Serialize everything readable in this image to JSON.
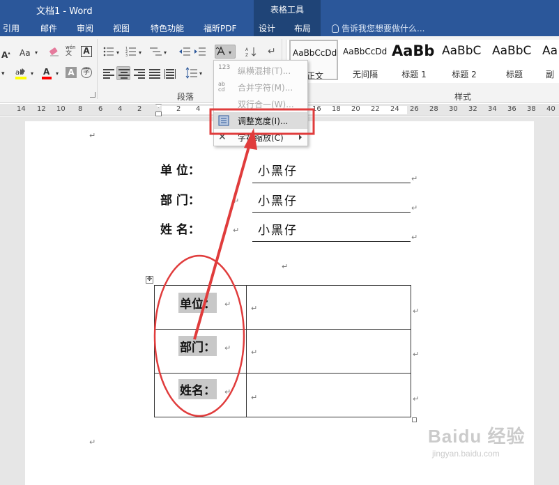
{
  "window": {
    "title": "文档1 - Word",
    "contextual_tab_group": "表格工具"
  },
  "tabs": [
    {
      "label": "引用"
    },
    {
      "label": "邮件"
    },
    {
      "label": "审阅"
    },
    {
      "label": "视图"
    },
    {
      "label": "特色功能"
    },
    {
      "label": "福昕PDF"
    },
    {
      "label": "设计"
    },
    {
      "label": "布局"
    }
  ],
  "tell_me": {
    "placeholder": "告诉我您想要做什么..."
  },
  "ribbon": {
    "font_size_btn": "Aa",
    "phonetic_btn": "wén",
    "char_border_btn": "A",
    "font_color_btn": "A",
    "shading_btn": "A",
    "enclose_btn": "字",
    "groups": {
      "paragraph_label": "段落",
      "styles_label": "样式"
    },
    "styles": [
      {
        "sample": "AaBbCcDd",
        "name": "正文",
        "active": true
      },
      {
        "sample": "AaBbCcDd",
        "name": "无间隔"
      },
      {
        "sample": "AaBb",
        "name": "标题 1"
      },
      {
        "sample": "AaBbC",
        "name": "标题 2"
      },
      {
        "sample": "AaBbC",
        "name": "标题"
      },
      {
        "sample": "Aa",
        "name": "副"
      }
    ],
    "colors": {
      "highlight": "#ffff00",
      "font_color": "#ff0000",
      "ribbon_blue": "#2b579a"
    }
  },
  "ruler": {
    "ticks": [
      "14",
      "12",
      "10",
      "8",
      "6",
      "4",
      "2",
      "2",
      "4",
      "16",
      "18",
      "20",
      "22",
      "24",
      "26",
      "28",
      "30",
      "32",
      "34",
      "36",
      "38",
      "40"
    ]
  },
  "context_menu": {
    "items": [
      {
        "icon": "123",
        "label": "纵横混排(T)...",
        "disabled": true
      },
      {
        "icon": "abcd",
        "label": "合并字符(M)...",
        "disabled": true
      },
      {
        "icon": "",
        "label": "双行合一(W)...",
        "disabled": true
      },
      {
        "icon": "width",
        "label": "调整宽度(I)...",
        "disabled": false,
        "highlighted": true
      },
      {
        "icon": "scale",
        "label": "字符缩放(C)",
        "disabled": false,
        "has_submenu": true
      }
    ]
  },
  "document": {
    "fields": [
      {
        "label": "单      位：",
        "value": "小黑仔"
      },
      {
        "label": "部      门：",
        "value": "小黑仔"
      },
      {
        "label": "姓      名：",
        "value": "小黑仔"
      }
    ],
    "table_rows": [
      {
        "label": "单位：",
        "value": ""
      },
      {
        "label": "部门：",
        "value": ""
      },
      {
        "label": "姓名：",
        "value": ""
      }
    ],
    "paragraph_mark": "↵"
  },
  "annotation": {
    "color": "#e03c3c"
  },
  "watermark": {
    "main": "Baidu 经验",
    "sub": "jingyan.baidu.com"
  }
}
